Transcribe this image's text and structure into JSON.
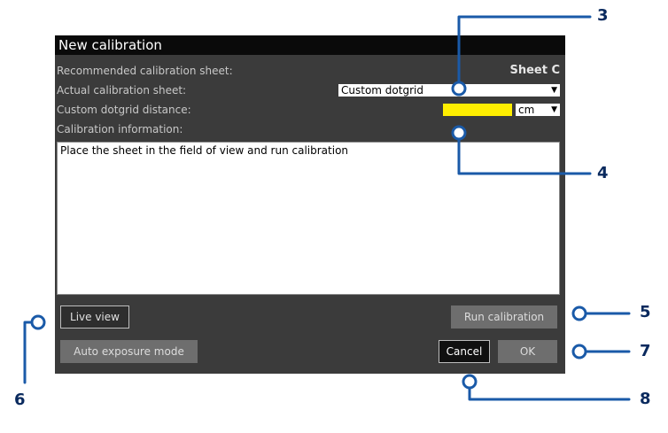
{
  "dialog": {
    "title": "New calibration",
    "recommended_label": "Recommended calibration sheet:",
    "recommended_value": "Sheet C",
    "actual_label": "Actual calibration sheet:",
    "actual_select_value": "Custom dotgrid",
    "distance_label": "Custom dotgrid distance:",
    "distance_unit": "cm",
    "info_label": "Calibration information:",
    "info_text": "Place the sheet in the field of view and run calibration",
    "buttons": {
      "live_view": "Live view",
      "run_calibration": "Run calibration",
      "auto_exposure": "Auto exposure mode",
      "cancel": "Cancel",
      "ok": "OK"
    }
  },
  "callouts": {
    "n3": "3",
    "n4": "4",
    "n5": "5",
    "n6": "6",
    "n7": "7",
    "n8": "8"
  },
  "colors": {
    "callout": "#1a5aa8",
    "callout_number": "#0a2a5e",
    "highlight_input": "#ffee00"
  }
}
